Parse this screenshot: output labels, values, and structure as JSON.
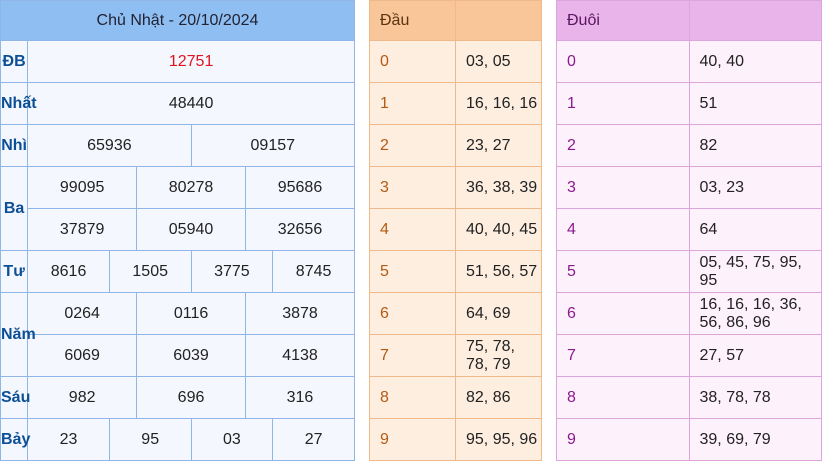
{
  "results": {
    "header": "Chủ Nhật - 20/10/2024",
    "db_label": "ĐB",
    "db": "12751",
    "nhat_label": "Nhất",
    "nhat": "48440",
    "nhi_label": "Nhì",
    "nhi": [
      "65936",
      "09157"
    ],
    "ba_label": "Ba",
    "ba": [
      "99095",
      "80278",
      "95686",
      "37879",
      "05940",
      "32656"
    ],
    "tu_label": "Tư",
    "tu": [
      "8616",
      "1505",
      "3775",
      "8745"
    ],
    "nam_label": "Năm",
    "nam": [
      "0264",
      "0116",
      "3878",
      "6069",
      "6039",
      "4138"
    ],
    "sau_label": "Sáu",
    "sau": [
      "982",
      "696",
      "316"
    ],
    "bay_label": "Bảy",
    "bay": [
      "23",
      "95",
      "03",
      "27"
    ],
    "special_color": "#e0141e"
  },
  "dau": {
    "header": "Đầu",
    "rows": [
      {
        "digit": "0",
        "values": "03, 05"
      },
      {
        "digit": "1",
        "values": "16, 16, 16"
      },
      {
        "digit": "2",
        "values": "23, 27"
      },
      {
        "digit": "3",
        "values": "36, 38, 39"
      },
      {
        "digit": "4",
        "values": "40, 40, 45"
      },
      {
        "digit": "5",
        "values": "51, 56, 57"
      },
      {
        "digit": "6",
        "values": "64, 69"
      },
      {
        "digit": "7",
        "values": "75, 78, 78, 79"
      },
      {
        "digit": "8",
        "values": "82, 86"
      },
      {
        "digit": "9",
        "values": "95, 95, 96"
      }
    ]
  },
  "duoi": {
    "header": "Đuôi",
    "rows": [
      {
        "digit": "0",
        "values": "40, 40"
      },
      {
        "digit": "1",
        "values": "51"
      },
      {
        "digit": "2",
        "values": "82"
      },
      {
        "digit": "3",
        "values": "03, 23"
      },
      {
        "digit": "4",
        "values": "64"
      },
      {
        "digit": "5",
        "values": "05, 45, 75, 95, 95"
      },
      {
        "digit": "6",
        "values": "16, 16, 16, 36, 56, 86, 96"
      },
      {
        "digit": "7",
        "values": "27, 57"
      },
      {
        "digit": "8",
        "values": "38, 78, 78"
      },
      {
        "digit": "9",
        "values": "39, 69, 79"
      }
    ]
  }
}
